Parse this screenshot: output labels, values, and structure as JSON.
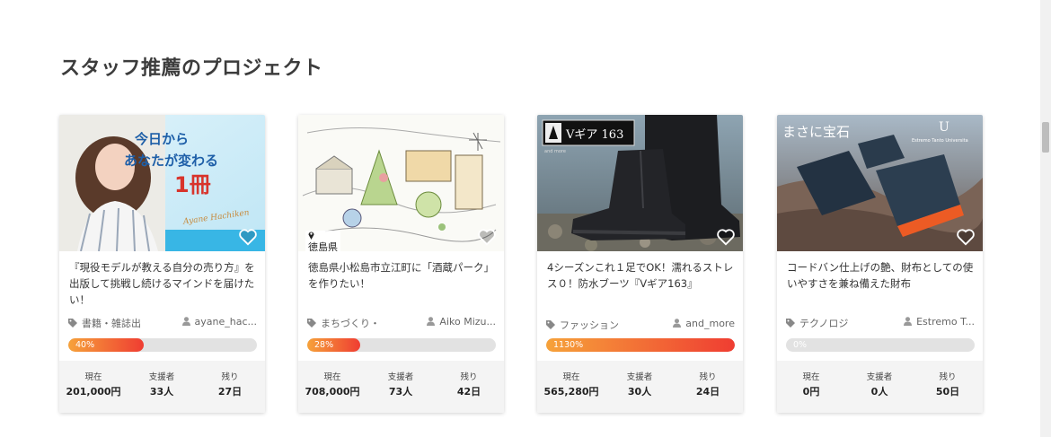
{
  "section": {
    "title": "スタッフ推薦のプロジェクト"
  },
  "stat_labels": {
    "current": "現在",
    "backers": "支援者",
    "remaining": "残り"
  },
  "colors": {
    "progress_start": "#f6a23a",
    "progress_end": "#ef3d32",
    "track": "#e2e2e2"
  },
  "cards": [
    {
      "title": "『現役モデルが教える自分の売り方』を出版して挑戦し続けるマインドを届けたい！",
      "image_text": {
        "line1": "今日から",
        "line2": "あなたが変わる",
        "line3": "1冊",
        "signature": "Ayane Hachiken"
      },
      "category": "書籍・雑誌出",
      "owner": "ayane_hac...",
      "progress": 40,
      "progress_label": "40%",
      "current": "201,000円",
      "backers": "33人",
      "remaining": "27日",
      "icons": {
        "category": "tag-icon",
        "owner": "user-icon",
        "like": "heart-icon"
      }
    },
    {
      "title": "徳島県小松島市立江町に「酒蔵パーク」を作りたい！",
      "location": "徳島県",
      "category": "まちづくり・",
      "owner": "Aiko Mizu...",
      "progress": 28,
      "progress_label": "28%",
      "current": "708,000円",
      "backers": "73人",
      "remaining": "42日",
      "icons": {
        "category": "tag-icon",
        "owner": "user-icon",
        "like": "heart-icon",
        "location": "map-pin-icon"
      }
    },
    {
      "title": "4シーズンこれ１足でOK！濡れるストレス０！防水ブーツ『Vギア163』",
      "image_text": {
        "badge": "Vギア 163",
        "badge_sub": "and more"
      },
      "category": "ファッション",
      "owner": "and_more",
      "progress": 100,
      "progress_label": "1130%",
      "current": "565,280円",
      "backers": "30人",
      "remaining": "24日",
      "icons": {
        "category": "tag-icon",
        "owner": "user-icon",
        "like": "heart-icon"
      }
    },
    {
      "title": "コードバン仕上げの艶、財布としての使いやすさを兼ね備えた財布",
      "image_text": {
        "headline": "まさに宝石",
        "brand_mark": "U",
        "brand": "Estremo Tanto Universita"
      },
      "category": "テクノロジ",
      "owner": "Estremo T...",
      "progress": 0,
      "progress_label": "0%",
      "current": "0円",
      "backers": "0人",
      "remaining": "50日",
      "icons": {
        "category": "tag-icon",
        "owner": "user-icon",
        "like": "heart-icon"
      }
    }
  ]
}
